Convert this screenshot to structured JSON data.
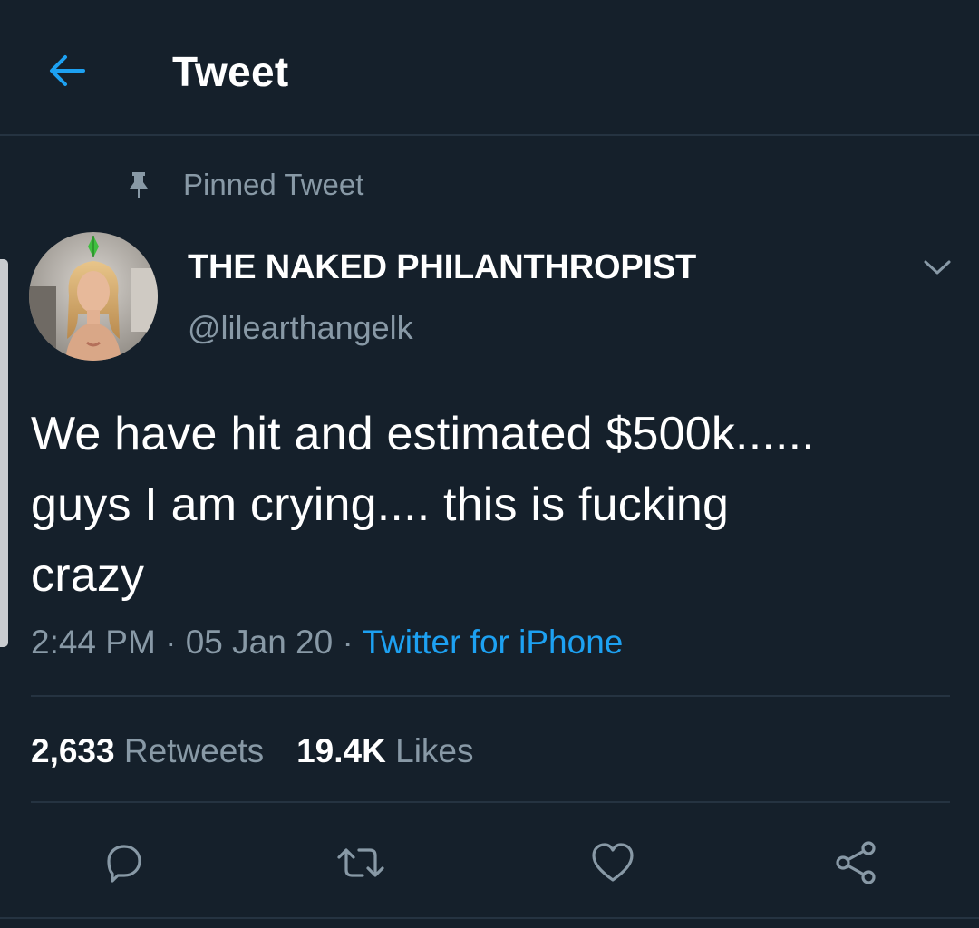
{
  "header": {
    "title": "Tweet",
    "back_icon": "arrow-left-icon",
    "accent_color": "#1da1f2"
  },
  "pinned": {
    "label": "Pinned Tweet",
    "icon": "pin-icon"
  },
  "author": {
    "display_name": "THE NAKED PHILANTHROPIST",
    "handle": "@lilearthangelk",
    "avatar_icon": "avatar"
  },
  "tweet": {
    "lines": [
      "We have hit and estimated $500k......",
      "guys I am crying.... this is fucking",
      "crazy"
    ],
    "time": "2:44 PM",
    "separator": " · ",
    "date": "05 Jan 20",
    "source": "Twitter for iPhone"
  },
  "stats": {
    "retweets_count": "2,633",
    "retweets_label": "Retweets",
    "likes_count": "19.4K",
    "likes_label": "Likes"
  },
  "actions": [
    "reply-icon",
    "retweet-icon",
    "like-icon",
    "share-icon"
  ],
  "colors": {
    "background": "#15202b",
    "secondary_text": "#8899a6",
    "divider": "#253341",
    "link": "#1da1f2"
  }
}
